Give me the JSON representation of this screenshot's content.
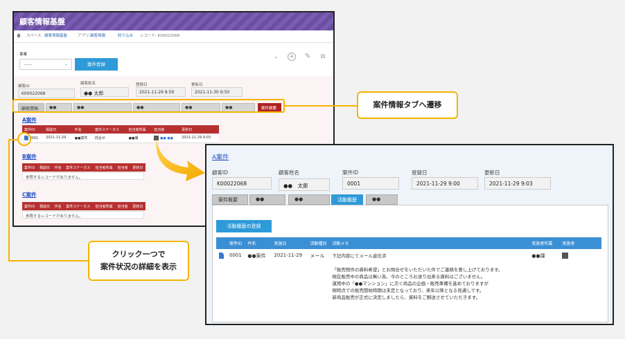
{
  "shot1": {
    "app_title": "顧客情報基盤",
    "breadcrumb": [
      {
        "text": "スペース:",
        "link": false
      },
      {
        "text": "顧客情報基盤",
        "link": true
      },
      {
        "text": "アプリ:",
        "link": false
      },
      {
        "text": "顧客情報",
        "link": true
      },
      {
        "text": "絞り込み",
        "link": true
      },
      {
        "text": "レコード: K00022068",
        "link": false
      }
    ],
    "business_label": "事業",
    "business_select_value": "-----",
    "register_button": "案件登録",
    "toolbar_icons": [
      "chevron-down-icon",
      "add-icon",
      "edit-icon",
      "copy-icon"
    ],
    "fields": [
      {
        "label": "顧客ID",
        "value": "K00022068"
      },
      {
        "label": "顧客姓名",
        "value": "●● 太郎"
      },
      {
        "label": "登録日",
        "value": "2021-11-29 8:59"
      },
      {
        "label": "更新日",
        "value": "2021-11-30 9:50"
      }
    ],
    "tabs": [
      "顧客情報",
      "●●",
      "●●",
      "●●",
      "●●",
      "●●",
      "案件概要"
    ],
    "sections": [
      {
        "title": "A案件",
        "headers": [
          "案件ID",
          "相談日",
          "件名",
          "案件ステータス",
          "担当者所属",
          "担当者",
          "更新日"
        ],
        "row": [
          "0001",
          "2021-11-29",
          "●●案件",
          "問合せ",
          "●●課",
          "●● ●●",
          "2021-11-29 9:03"
        ]
      },
      {
        "title": "B案件",
        "headers": [
          "案件ID",
          "相談日",
          "件名",
          "案件ステータス",
          "担当者所属",
          "担当者",
          "更新日"
        ],
        "empty": "参照するレコードがありません。"
      },
      {
        "title": "C案件",
        "headers": [
          "案件ID",
          "相談日",
          "件名",
          "案件ステータス",
          "担当者所属",
          "担当者",
          "更新日"
        ],
        "empty": "参照するレコードがありません。"
      }
    ]
  },
  "callouts": {
    "tab_callout": "案件情報タブへ遷移",
    "click_callout_line1": "クリック一つで",
    "click_callout_line2": "案件状況の詳細を表示"
  },
  "shot2": {
    "title": "A案件",
    "fields": [
      {
        "label": "顧客ID",
        "value": "K00022068"
      },
      {
        "label": "顧客姓名",
        "value": "●●　太郎"
      },
      {
        "label": "案件ID",
        "value": "0001"
      },
      {
        "label": "登録日",
        "value": "2021-11-29 9:00"
      },
      {
        "label": "更新日",
        "value": "2021-11-29 9:03"
      }
    ],
    "tabs": [
      "案件概要",
      "●●",
      "●●",
      "活動履歴",
      "●●"
    ],
    "active_tab": "活動履歴",
    "register_button": "活動履歴の登録",
    "headers": [
      "案件ID",
      "件名",
      "実施日",
      "活動種別",
      "活動メモ",
      "実施者所属",
      "実施者"
    ],
    "row": {
      "id": "0001",
      "subject": "●●案件",
      "date": "2021-11-29",
      "type": "メール",
      "memo": [
        "下記内容にてメール返信済",
        "",
        "「販売物件の資料希望」とお問合せをいただいた件でご連絡を差し上げております。",
        "現在販売中の商品は無い為、今のところお送り出来る資料はございません。",
        "運用中の「●●マンション」に次ぐ商品の企画・販売準備を進めておりますが",
        "現時点での販売開始時期は未定となっており、来年以降となる見通しです。",
        "新商品販売が正式に決定しましたら、資料をご郵送させていただきます。"
      ],
      "dept": "●●課"
    }
  },
  "colors": {
    "accent": "#f5b400",
    "header_purple": "#6a4fa0",
    "table_red": "#b73030",
    "table_blue": "#3b8fd4",
    "button_blue": "#2e9ad8"
  }
}
